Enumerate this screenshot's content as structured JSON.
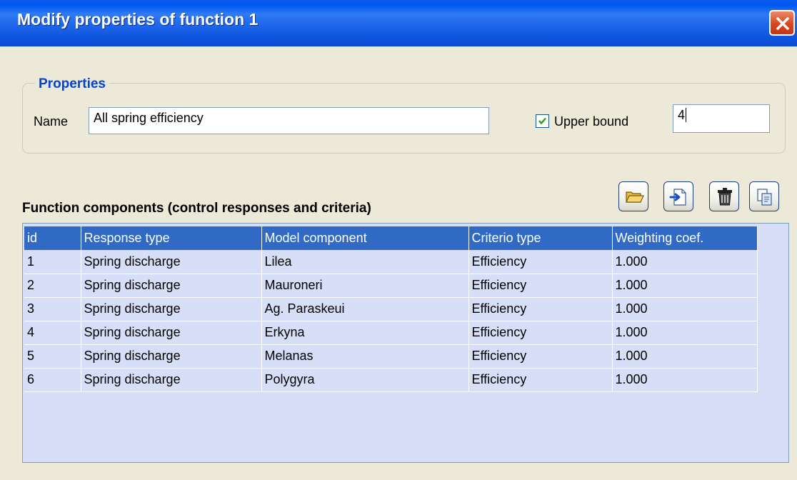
{
  "window": {
    "title": "Modify properties of function 1"
  },
  "properties": {
    "legend": "Properties",
    "name_label": "Name",
    "name_value": "All spring efficiency",
    "upper_bound_label": "Upper bound",
    "upper_bound_checked": true,
    "upper_bound_value": "4"
  },
  "components": {
    "title": "Function components (control responses and criteria)",
    "toolbar": [
      "open-folder-icon",
      "import-icon",
      "trash-icon",
      "copy-icon"
    ],
    "columns": [
      "id",
      "Response type",
      "Model component",
      "Criterio type",
      "Weighting coef."
    ],
    "rows": [
      [
        "1",
        "Spring discharge",
        "Lilea",
        "Efficiency",
        "1.000"
      ],
      [
        "2",
        "Spring discharge",
        "Mauroneri",
        "Efficiency",
        "1.000"
      ],
      [
        "3",
        "Spring discharge",
        "Ag. Paraskeui",
        "Efficiency",
        "1.000"
      ],
      [
        "4",
        "Spring discharge",
        "Erkyna",
        "Efficiency",
        "1.000"
      ],
      [
        "5",
        "Spring discharge",
        "Melanas",
        "Efficiency",
        "1.000"
      ],
      [
        "6",
        "Spring discharge",
        "Polygyra",
        "Efficiency",
        "1.000"
      ]
    ]
  },
  "colors": {
    "titlebar": "#0A5BEF",
    "legend": "#0046D5",
    "header_row": "#316AC5",
    "table_bg": "#D6DFF7"
  }
}
